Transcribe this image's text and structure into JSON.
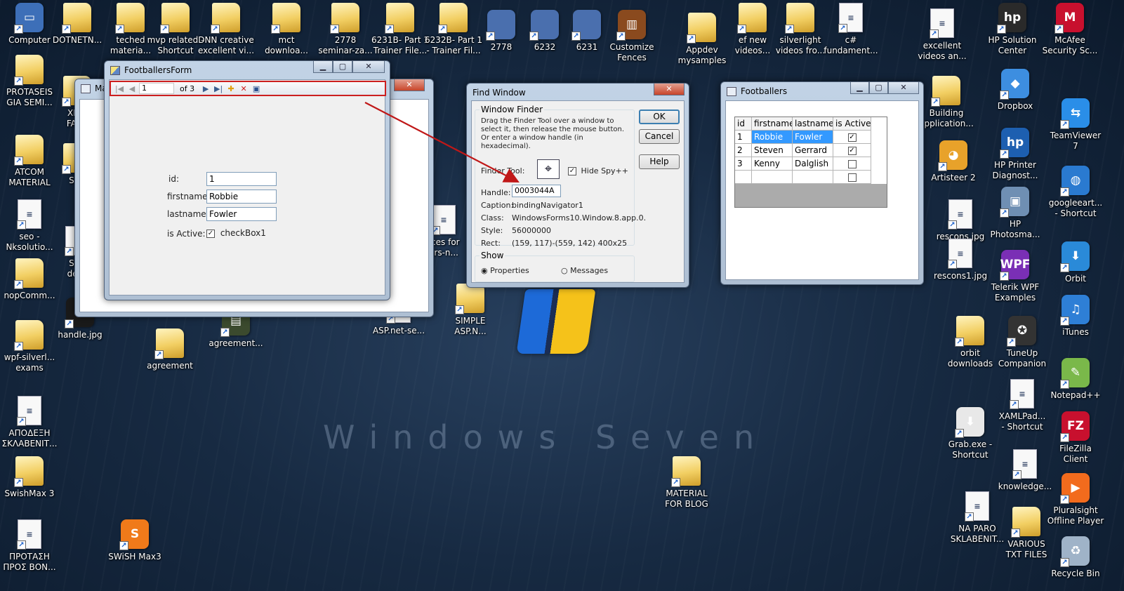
{
  "desktop": {
    "watermark": "Windows Seven",
    "icons": [
      {
        "label": "Computer",
        "kind": "app",
        "color": "#3d6fb8",
        "glyph": "▭"
      },
      {
        "label": "DOTNETN...",
        "kind": "folder"
      },
      {
        "label": "teched\nmateria...",
        "kind": "folder"
      },
      {
        "label": "mvp related -\nShortcut",
        "kind": "folder"
      },
      {
        "label": "DNN creative\nexcellent vi...",
        "kind": "folder"
      },
      {
        "label": "mct\ndownloa...",
        "kind": "folder"
      },
      {
        "label": "2778\nseminar-za...",
        "kind": "folder"
      },
      {
        "label": "6231B- Part 1\nTrainer File...",
        "kind": "folder"
      },
      {
        "label": "6232B- Part 1\n- Trainer Fil...",
        "kind": "folder"
      },
      {
        "label": "2778",
        "kind": "app",
        "color": "#4a6fae",
        "glyph": ""
      },
      {
        "label": "6232",
        "kind": "app",
        "color": "#4a6fae",
        "glyph": ""
      },
      {
        "label": "6231",
        "kind": "app",
        "color": "#4a6fae",
        "glyph": ""
      },
      {
        "label": "Customize\nFences",
        "kind": "app",
        "color": "#8a4a1e",
        "glyph": "▥"
      },
      {
        "label": "Appdev\nmysamples",
        "kind": "folder"
      },
      {
        "label": "ef new\nvideos...",
        "kind": "folder"
      },
      {
        "label": "silverlight\nvideos fro...",
        "kind": "folder"
      },
      {
        "label": "c#\nfundament...",
        "kind": "doc"
      },
      {
        "label": "excellent\nvideos an...",
        "kind": "doc"
      },
      {
        "label": "HP Solution\nCenter",
        "kind": "app",
        "color": "#2a2a2a",
        "glyph": "hp"
      },
      {
        "label": "McAfee\nSecurity Sc...",
        "kind": "app",
        "color": "#c8102e",
        "glyph": "M"
      },
      {
        "label": "PROTASEIS\nGIA SEMI...",
        "kind": "folder"
      },
      {
        "label": "XMO\nFANT",
        "kind": "folder"
      },
      {
        "label": "ATCOM\nMATERIAL",
        "kind": "folder"
      },
      {
        "label": "SQL\nt",
        "kind": "folder"
      },
      {
        "label": "seo -\nNksolutio...",
        "kind": "doc"
      },
      {
        "label": "SQL\ndevc",
        "kind": "doc"
      },
      {
        "label": "nopComm...",
        "kind": "folder"
      },
      {
        "label": "wpf-silverl...\nexams",
        "kind": "folder"
      },
      {
        "label": "handle.jpg",
        "kind": "app",
        "color": "#1a1a1a",
        "glyph": ""
      },
      {
        "label": "agreement",
        "kind": "folder"
      },
      {
        "label": "agreement...",
        "kind": "app",
        "color": "#3b4a2e",
        "glyph": "▤"
      },
      {
        "label": "ASP.net-se...",
        "kind": "doc"
      },
      {
        "label": "SIMPLE\nASP.N...",
        "kind": "folder"
      },
      {
        "label": "rces for\nars-n...",
        "kind": "doc"
      },
      {
        "label": "ΑΠΟΔΕΞΗ\nΣΚΛΑΒΕΝΙΤ...",
        "kind": "doc"
      },
      {
        "label": "SwishMax 3",
        "kind": "folder"
      },
      {
        "label": "ΠΡΟΤΑΣΗ\nΠΡΟΣ ΒΟΝ...",
        "kind": "doc"
      },
      {
        "label": "SWiSH Max3",
        "kind": "app",
        "color": "#f07a1a",
        "glyph": "S"
      },
      {
        "label": "MATERIAL\nFOR BLOG",
        "kind": "folder"
      },
      {
        "label": "Building\napplication...",
        "kind": "folder"
      },
      {
        "label": "Artisteer 2",
        "kind": "app",
        "color": "#e8a22a",
        "glyph": "◕"
      },
      {
        "label": "rescons.jpg",
        "kind": "doc"
      },
      {
        "label": "rescons1.jpg",
        "kind": "doc"
      },
      {
        "label": "orbit\ndownloads",
        "kind": "folder"
      },
      {
        "label": "Grab.exe -\nShortcut",
        "kind": "app",
        "color": "#e8e8e8",
        "glyph": "⬇"
      },
      {
        "label": "NA PARO\nSKLABENIT...",
        "kind": "doc"
      },
      {
        "label": "VARIOUS\nTXT FILES",
        "kind": "folder"
      },
      {
        "label": "Dropbox",
        "kind": "app",
        "color": "#3d8ee0",
        "glyph": "◆"
      },
      {
        "label": "HP Printer\nDiagnost...",
        "kind": "app",
        "color": "#1d5fb0",
        "glyph": "hp"
      },
      {
        "label": "HP\nPhotosma...",
        "kind": "app",
        "color": "#6f8fb3",
        "glyph": "▣"
      },
      {
        "label": "Telerik WPF\nExamples",
        "kind": "app",
        "color": "#7a2fb5",
        "glyph": "WPF"
      },
      {
        "label": "TuneUp\nCompanion",
        "kind": "app",
        "color": "#333333",
        "glyph": "✪"
      },
      {
        "label": "XAMLPad...\n- Shortcut",
        "kind": "doc"
      },
      {
        "label": "knowledge...",
        "kind": "doc"
      },
      {
        "label": "TeamViewer\n7",
        "kind": "app",
        "color": "#2a8ee8",
        "glyph": "⇆"
      },
      {
        "label": "googleeart...\n- Shortcut",
        "kind": "app",
        "color": "#2a7ad0",
        "glyph": "◍"
      },
      {
        "label": "Orbit",
        "kind": "app",
        "color": "#2a8ad8",
        "glyph": "⬇"
      },
      {
        "label": "iTunes",
        "kind": "app",
        "color": "#2e7fd6",
        "glyph": "♫"
      },
      {
        "label": "Notepad++",
        "kind": "app",
        "color": "#7ab84a",
        "glyph": "✎"
      },
      {
        "label": "FileZilla\nClient",
        "kind": "app",
        "color": "#c8102e",
        "glyph": "FZ"
      },
      {
        "label": "Pluralsight\nOffline Player",
        "kind": "app",
        "color": "#f26b1d",
        "glyph": "▶"
      },
      {
        "label": "Recycle Bin",
        "kind": "app",
        "color": "#9fb3c8",
        "glyph": "♻"
      }
    ]
  },
  "main_window": {
    "title_fragment": "Ma"
  },
  "footballers_form": {
    "title": "FootballersForm",
    "navigator": {
      "position": "1",
      "count": "of 3"
    },
    "fields": {
      "id_label": "id:",
      "id_value": "1",
      "firstname_label": "firstname:",
      "firstname_value": "Robbie",
      "lastname_label": "lastname:",
      "lastname_value": "Fowler",
      "active_label": "is Active:",
      "active_text": "checkBox1"
    }
  },
  "find_window": {
    "title": "Find Window",
    "group_title": "Window Finder",
    "instructions": "Drag the Finder Tool over a window to select it, then release the mouse button.  Or enter a window handle (in hexadecimal).",
    "finder_tool_label": "Finder Tool:",
    "hide_spy_label": "Hide Spy++",
    "handle_label": "Handle:",
    "handle_value": "0003044A",
    "caption_label": "Caption:",
    "caption_value": "bindingNavigator1",
    "class_label": "Class:",
    "class_value": "WindowsForms10.Window.8.app.0.",
    "style_label": "Style:",
    "style_value": "56000000",
    "rect_label": "Rect:",
    "rect_value": "(159, 117)-(559, 142) 400x25",
    "show_group": "Show",
    "properties_label": "Properties",
    "messages_label": "Messages",
    "ok": "OK",
    "cancel": "Cancel",
    "help": "Help"
  },
  "footballers_grid": {
    "title": "Footballers",
    "headers": [
      "id",
      "firstname",
      "lastname",
      "is Active"
    ],
    "rows": [
      {
        "id": "1",
        "firstname": "Robbie",
        "lastname": "Fowler",
        "active": true
      },
      {
        "id": "2",
        "firstname": "Steven",
        "lastname": "Gerrard",
        "active": true
      },
      {
        "id": "3",
        "firstname": "Kenny",
        "lastname": "Dalglish",
        "active": false
      }
    ]
  },
  "colors": {
    "highlight_box": "#cc1f1f",
    "arrow": "#c01818",
    "selection": "#3399ff"
  }
}
